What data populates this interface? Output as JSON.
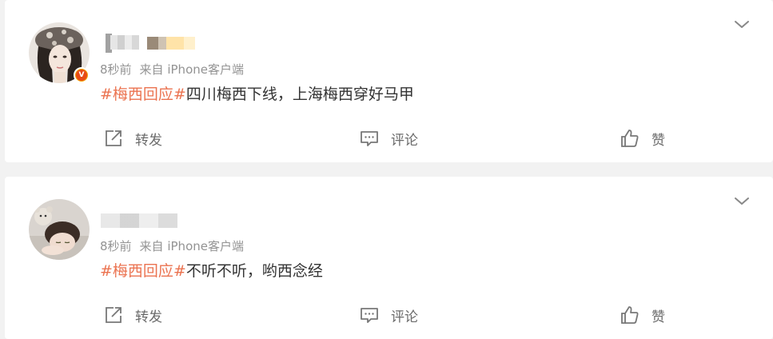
{
  "posts": [
    {
      "meta": {
        "time": "8秒前",
        "source_prefix": "来自",
        "source": "iPhone客户端"
      },
      "content": {
        "hashtag": "#梅西回应#",
        "text": "四川梅西下线，上海梅西穿好马甲"
      },
      "verified_badge": "V",
      "actions": {
        "repost": "转发",
        "comment": "评论",
        "like": "赞"
      }
    },
    {
      "meta": {
        "time": "8秒前",
        "source_prefix": "来自",
        "source": "iPhone客户端"
      },
      "content": {
        "hashtag": "#梅西回应#",
        "text": "不听不听，哟西念经"
      },
      "actions": {
        "repost": "转发",
        "comment": "评论",
        "like": "赞"
      }
    }
  ],
  "colors": {
    "hashtag": "#eb7350",
    "meta": "#939393",
    "text": "#333333",
    "background": "#f2f2f2",
    "verified_badge": "#e84b16"
  },
  "icons": {
    "more": "chevron-down-icon",
    "repost": "share-icon",
    "comment": "comment-icon",
    "like": "thumbs-up-icon"
  }
}
